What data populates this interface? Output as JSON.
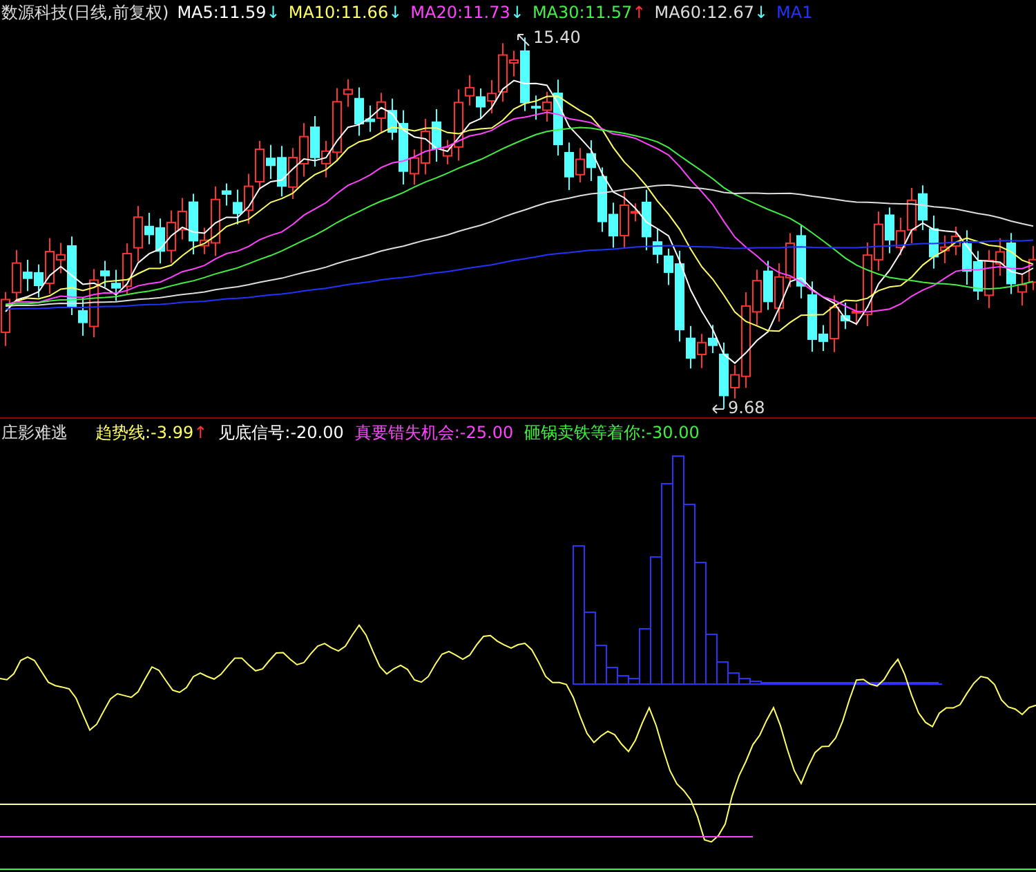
{
  "price_panel": {
    "title": "数源科技(日线,前复权)",
    "legend": [
      {
        "label": "MA5:11.59",
        "color": "#ffffff",
        "arrow": {
          "text": "↓",
          "color": "#55ffff"
        }
      },
      {
        "label": "MA10:11.66",
        "color": "#ffff66",
        "arrow": {
          "text": "↓",
          "color": "#55ffff"
        }
      },
      {
        "label": "MA20:11.73",
        "color": "#ff44ff",
        "arrow": {
          "text": "↓",
          "color": "#55ffff"
        }
      },
      {
        "label": "MA30:11.57",
        "color": "#44ee44",
        "arrow": {
          "text": "↑",
          "color": "#ff3333"
        }
      },
      {
        "label": "MA60:12.67",
        "color": "#dddddd",
        "arrow": {
          "text": "↓",
          "color": "#55ffff"
        }
      },
      {
        "label": "MA1",
        "color": "#2233ff"
      }
    ],
    "high_label": "15.40",
    "low_label": "9.68"
  },
  "indicator_panel": {
    "title": "庄影难逃",
    "legend": [
      {
        "label": "趋势线:-3.99",
        "color": "#ffff66",
        "arrow": {
          "text": "↑",
          "color": "#ff3333"
        }
      },
      {
        "label": "见底信号:-20.00",
        "color": "#ffffff"
      },
      {
        "label": "真要错失机会:-25.00",
        "color": "#ff44ff"
      },
      {
        "label": "砸锅卖铁等着你:-30.00",
        "color": "#44ee44"
      }
    ]
  }
}
